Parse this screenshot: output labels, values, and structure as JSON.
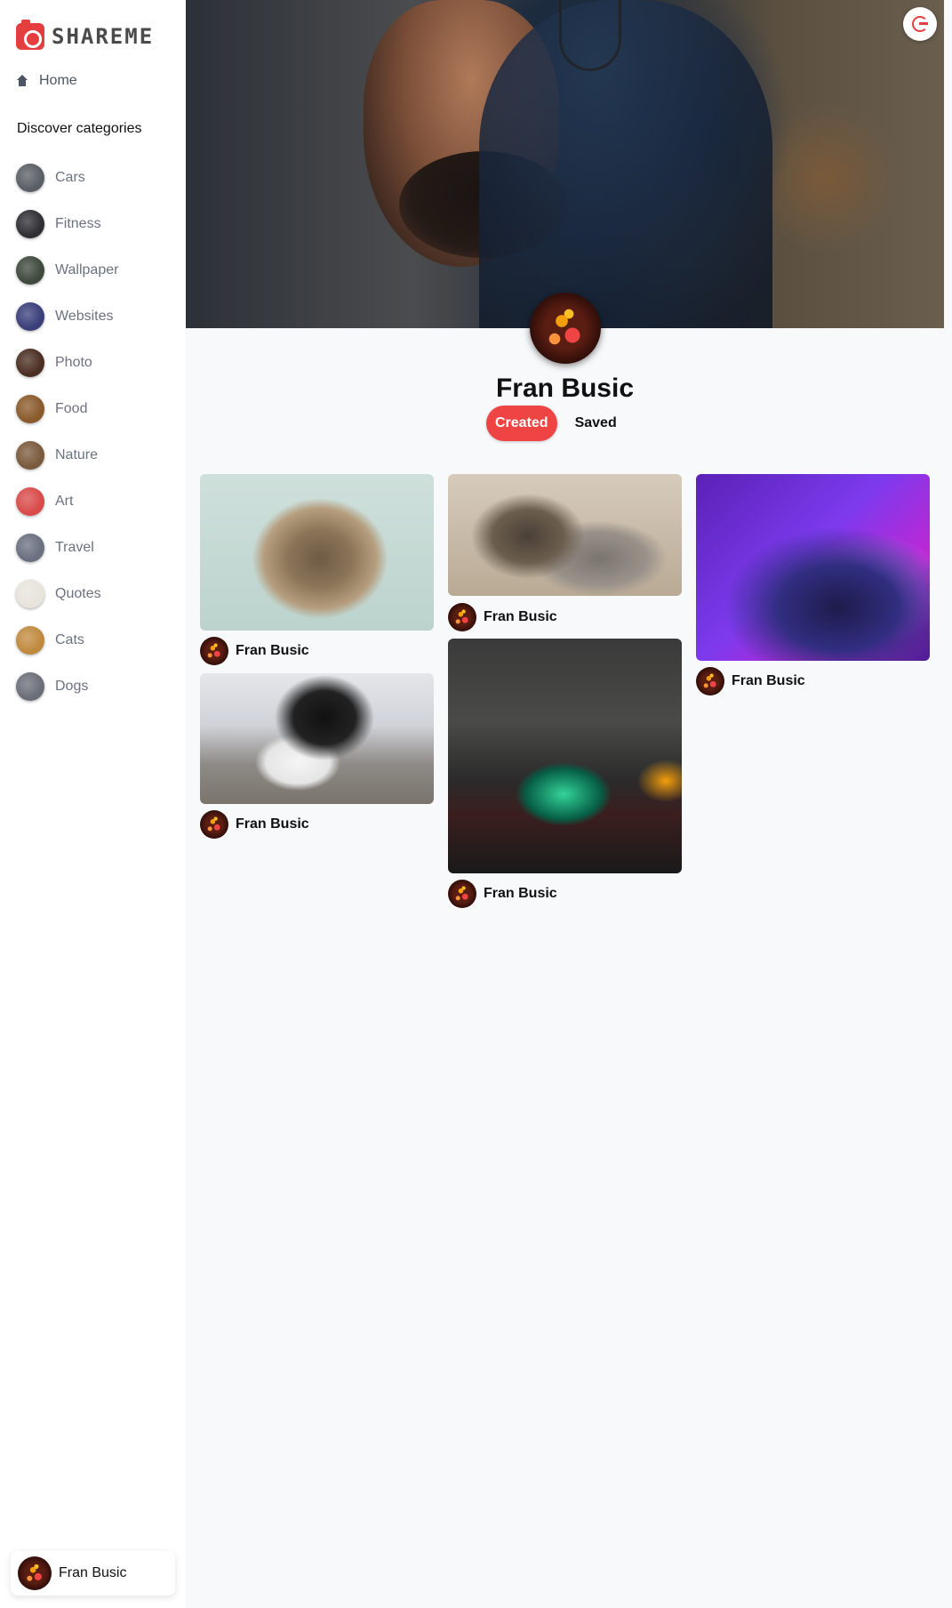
{
  "app": {
    "logo_text": "SHAREME",
    "accent": "#ef4444"
  },
  "sidebar": {
    "home_label": "Home",
    "discover_title": "Discover categories",
    "categories": [
      {
        "label": "Cars",
        "thumb": "#5a5f66"
      },
      {
        "label": "Fitness",
        "thumb": "#2f2f33"
      },
      {
        "label": "Wallpaper",
        "thumb": "#3e4a3c"
      },
      {
        "label": "Websites",
        "thumb": "#3a3f7a"
      },
      {
        "label": "Photo",
        "thumb": "#4b2e22"
      },
      {
        "label": "Food",
        "thumb": "#8a5a2b"
      },
      {
        "label": "Nature",
        "thumb": "#7a5a3c"
      },
      {
        "label": "Art",
        "thumb": "#d94a4a"
      },
      {
        "label": "Travel",
        "thumb": "#6a7080"
      },
      {
        "label": "Quotes",
        "thumb": "#e8e4dc"
      },
      {
        "label": "Cats",
        "thumb": "#c08a3e"
      },
      {
        "label": "Dogs",
        "thumb": "#6a6e78"
      }
    ],
    "user_name": "Fran Busic"
  },
  "profile": {
    "name": "Fran Busic",
    "tabs": [
      {
        "label": "Created",
        "active": true
      },
      {
        "label": "Saved",
        "active": false
      }
    ]
  },
  "pins": [
    {
      "author": "Fran Busic",
      "subject": "fluffy cat"
    },
    {
      "author": "Fran Busic",
      "subject": "two tabby cats"
    },
    {
      "author": "Fran Busic",
      "subject": "purple laptop"
    },
    {
      "author": "Fran Busic",
      "subject": "black and white cat"
    },
    {
      "author": "Fran Busic",
      "subject": "gaming desk setup"
    }
  ]
}
